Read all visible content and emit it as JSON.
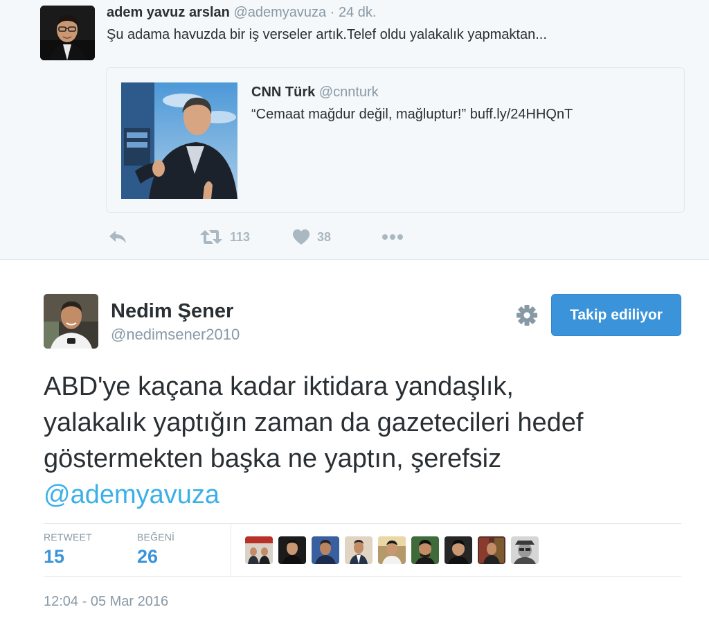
{
  "quoted_tweet": {
    "author_name": "adem yavuz arslan",
    "author_handle": "@ademyavuza",
    "separator": "·",
    "time": "24 dk.",
    "text": "Şu adama havuzda bir iş verseler artık.Telef oldu yalakalık yapmaktan...",
    "quote": {
      "author_name": "CNN Türk",
      "author_handle": "@cnnturk",
      "text": "“Cemaat mağdur değil, mağluptur!” buff.ly/24HHQnT"
    },
    "actions": {
      "reply_icon": "reply-icon",
      "retweet_icon": "retweet-icon",
      "retweet_count": "113",
      "like_icon": "heart-icon",
      "like_count": "38",
      "more_icon": "more-dots-icon"
    }
  },
  "main_tweet": {
    "author_name": "Nedim Şener",
    "author_handle": "@nedimsener2010",
    "settings_icon": "gear-icon",
    "follow_button_label": "Takip ediliyor",
    "text_line_1": "ABD'ye kaçana kadar iktidara yandaşlık,",
    "text_line_2": "yalakalık yaptığın zaman da gazetecileri hedef",
    "text_line_3": "göstermekten başka ne yaptın, şerefsiz",
    "mention": "@ademyavuza",
    "stats": {
      "retweet_label": "RETWEET",
      "retweet_value": "15",
      "like_label": "BEĞENİ",
      "like_value": "26"
    },
    "liker_avatars_count": 9,
    "timestamp": "12:04 - 05 Mar 2016"
  },
  "colors": {
    "accent_blue": "#3b94d9",
    "mention_blue": "#3bb0e8",
    "muted_gray": "#8899a6",
    "icon_gray": "#aab8c2",
    "top_background": "#f5f8fa"
  }
}
